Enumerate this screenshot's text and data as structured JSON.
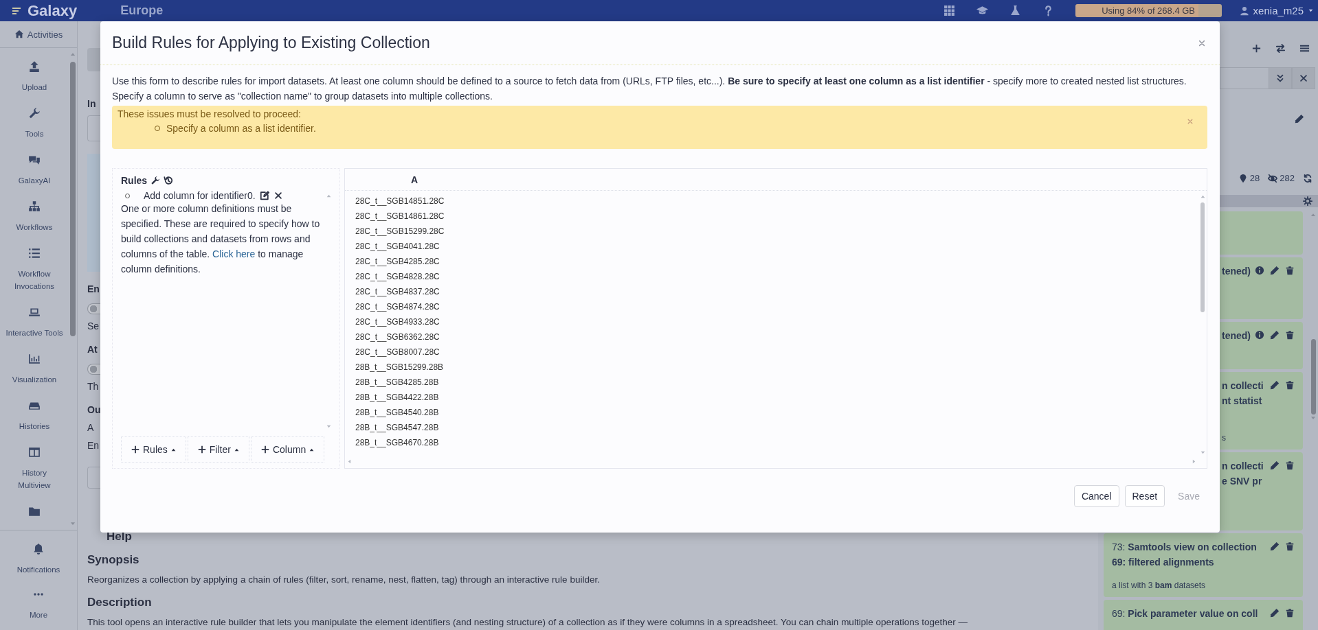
{
  "navbar": {
    "brand": "Galaxy",
    "subtitle": "Europe",
    "storage": {
      "label": "Using 84% of 268.4 GB",
      "level": 0.84
    },
    "user": "xenia_m25"
  },
  "activity_bar": {
    "header": "Activities",
    "items": [
      {
        "kind": "upload",
        "label": "Upload"
      },
      {
        "kind": "tools",
        "label": "Tools"
      },
      {
        "kind": "ai",
        "label": "GalaxyAI"
      },
      {
        "kind": "workflows",
        "label": "Workflows"
      },
      {
        "kind": "invocations",
        "label": "Workflow Invocations"
      },
      {
        "kind": "interactive",
        "label": "Interactive Tools"
      },
      {
        "kind": "visualization",
        "label": "Visualization"
      },
      {
        "kind": "histories",
        "label": "Histories"
      },
      {
        "kind": "multiview",
        "label": "History Multiview"
      },
      {
        "kind": "datasets"
      }
    ],
    "bottom_items": [
      {
        "kind": "notifications",
        "label": "Notifications"
      },
      {
        "kind": "more",
        "label": "More"
      }
    ]
  },
  "tool_form": {
    "parts": [
      {
        "kind": "back"
      },
      {
        "kind": "heading",
        "text": "In"
      },
      {
        "kind": "field"
      },
      {
        "kind": "panel"
      },
      {
        "kind": "heading",
        "text": "En"
      },
      {
        "kind": "toggle",
        "on": false
      },
      {
        "kind": "text",
        "text": "Se"
      },
      {
        "kind": "heading",
        "text": "At"
      },
      {
        "kind": "toggle",
        "on": false
      },
      {
        "kind": "text",
        "text": "Th"
      },
      {
        "kind": "heading",
        "text": "Ou"
      },
      {
        "kind": "text",
        "text": "A"
      },
      {
        "kind": "text",
        "text": "En"
      },
      {
        "kind": "button"
      }
    ],
    "help": {
      "title": "Help",
      "sections": [
        {
          "heading": "Synopsis",
          "text": "Reorganizes a collection by applying a chain of rules (filter, sort, rename, nest, flatten, tag) through an interactive rule builder."
        },
        {
          "heading": "Description",
          "text": "This tool opens an interactive rule builder that lets you manipulate the element identifiers (and nesting structure) of a collection as if they were columns in a spreadsheet. You can chain multiple operations together —"
        }
      ]
    }
  },
  "history_panel": {
    "counts": [
      {
        "kind": "shown",
        "text": "28"
      },
      {
        "kind": "hidden",
        "text": "282"
      }
    ],
    "items": [
      {
        "kind": "plain"
      },
      {
        "kind": "dataset",
        "title_lines": [
          "tened)"
        ]
      },
      {
        "kind": "dataset",
        "title_lines": [
          "tened)"
        ]
      },
      {
        "kind": "collection",
        "title_lines": [
          "n collecti",
          "nt statist"
        ],
        "subtitle": "s"
      },
      {
        "kind": "collection",
        "title_lines": [
          "n collecti",
          "e SNV pr"
        ]
      },
      {
        "kind": "collection",
        "title_lines": [
          "73: **Samtools view on collection**",
          "**69: filtered alignments**"
        ],
        "subtitle": "a list with 3 **bam** datasets"
      },
      {
        "kind": "collection",
        "title_lines": [
          "69: **Pick parameter value on coll**"
        ]
      }
    ]
  },
  "dialog": {
    "title": "Build Rules for Applying to Existing Collection",
    "description": "Use this form to describe rules for import datasets. At least one column should be defined to a source to fetch data from (URLs, FTP files, etc...). **Be sure to specify at least one column as a list identifier** - specify more to created nested list structures. Specify a column to serve as \"collection name\" to group datasets into multiple collections.",
    "alert": {
      "heading": "These issues must be resolved to proceed:",
      "items": [
        "Specify a column as a list identifier."
      ]
    },
    "rules": {
      "title": "Rules",
      "items": [
        "Add column for identifier0."
      ],
      "message_before": "One or more column definitions must be specified. These are required to specify how to build collections and datasets from rows and columns of the table.",
      "link": "Click here",
      "message_after": "to manage column definitions.",
      "buttons": [
        "Rules",
        "Filter",
        "Column"
      ]
    },
    "table": {
      "columns": [
        "A"
      ],
      "rows": [
        "28C_t__SGB14851.28C",
        "28C_t__SGB14861.28C",
        "28C_t__SGB15299.28C",
        "28C_t__SGB4041.28C",
        "28C_t__SGB4285.28C",
        "28C_t__SGB4828.28C",
        "28C_t__SGB4837.28C",
        "28C_t__SGB4874.28C",
        "28C_t__SGB4933.28C",
        "28C_t__SGB6362.28C",
        "28C_t__SGB8007.28C",
        "28B_t__SGB15299.28B",
        "28B_t__SGB4285.28B",
        "28B_t__SGB4422.28B",
        "28B_t__SGB4540.28B",
        "28B_t__SGB4547.28B",
        "28B_t__SGB4670.28B"
      ]
    },
    "buttons": [
      {
        "label": "Cancel",
        "disabled": false
      },
      {
        "label": "Reset",
        "disabled": false
      },
      {
        "label": "Save",
        "disabled": true
      }
    ]
  }
}
